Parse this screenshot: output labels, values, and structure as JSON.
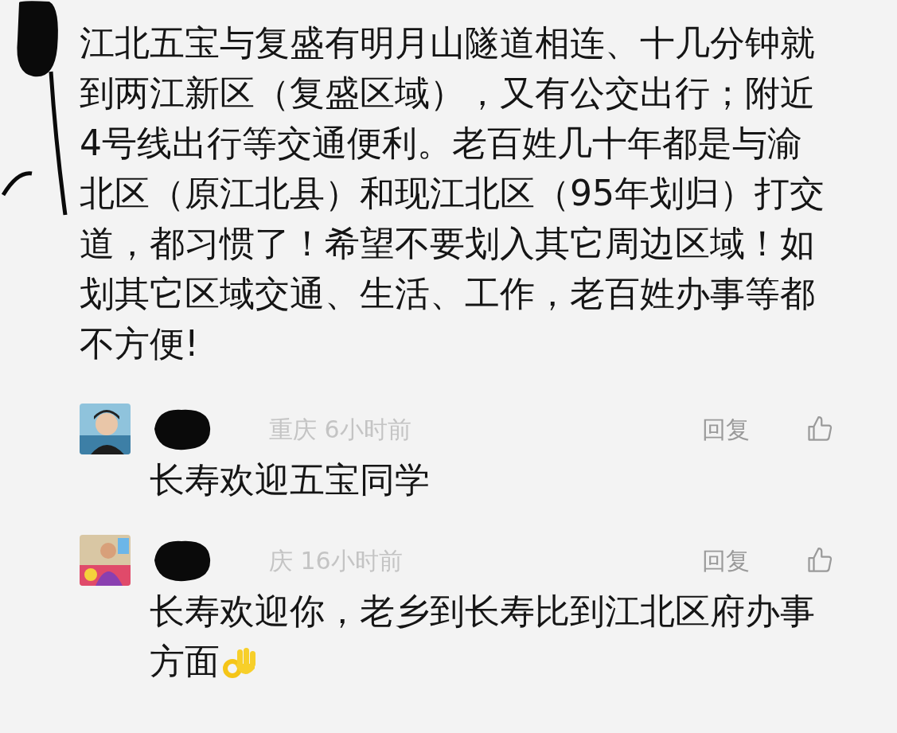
{
  "comment": {
    "text": "江北五宝与复盛有明月山隧道相连、十几分钟就到两江新区（复盛区域），又有公交出行；附近4号线出行等交通便利。老百姓几十年都是与渝北区（原江北县）和现江北区（95年划归）打交道，都习惯了！希望不要划入其它周边区域！如划其它区域交通、生活、工作，老百姓办事等都不方便!"
  },
  "replies": [
    {
      "meta": "重庆 6小时前",
      "reply": "回复",
      "text": "长寿欢迎五宝同学",
      "emoji": false
    },
    {
      "meta": "庆 16小时前",
      "reply": "回复",
      "text": "长寿欢迎你，老乡到长寿比到江北区府办事方面",
      "emoji": true
    }
  ]
}
